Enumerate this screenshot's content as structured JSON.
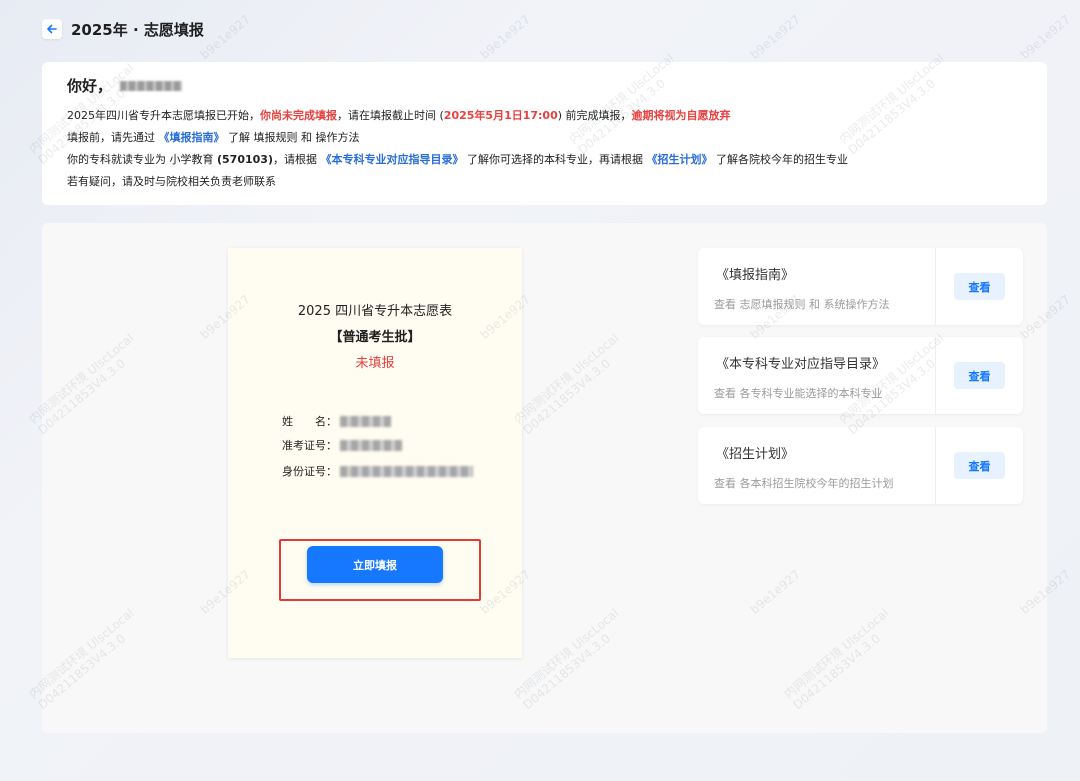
{
  "header": {
    "title": "2025年 · 志愿填报",
    "back_icon": "arrow-left-icon"
  },
  "notice": {
    "greeting": "你好，",
    "line1": {
      "p1": "2025年四川省专升本志愿填报已开始，",
      "warn": "你尚未完成填报",
      "p2": "，请在填报截止时间 (",
      "deadline": "2025年5月1日17:00",
      "p3": ") 前完成填报，",
      "penalty": "逾期将视为自愿放弃"
    },
    "line2": {
      "p1": "填报前，请先通过 ",
      "link": "《填报指南》",
      "p2": " 了解 填报规则 和 操作方法"
    },
    "line3": {
      "p1": "你的专科就读专业为 小学教育 ",
      "major_code": "(570103)",
      "p2": "，请根据 ",
      "link1": "《本专科专业对应指导目录》",
      "p3": " 了解你可选择的本科专业，再请根据 ",
      "link2": "《招生计划》",
      "p4": " 了解各院校今年的招生专业"
    },
    "line4": "若有疑问，请及时与院校相关负责老师联系"
  },
  "form": {
    "title": "2025 四川省专升本志愿表",
    "batch": "【普通考生批】",
    "status": "未填报",
    "name_label": "姓　　名：",
    "exam_no_label": "准考证号：",
    "id_no_label": "身份证号：",
    "submit_label": "立即填报"
  },
  "links": [
    {
      "title": "《填报指南》",
      "desc": "查看 志愿填报规则 和 系统操作方法",
      "button": "查看"
    },
    {
      "title": "《本专科专业对应指导目录》",
      "desc": "查看 各专科专业能选择的本科专业",
      "button": "查看"
    },
    {
      "title": "《招生计划》",
      "desc": "查看 各本科招生院校今年的招生计划",
      "button": "查看"
    }
  ],
  "watermark": {
    "line1": "内网测试环境 UlscLocal",
    "line2": "D04211853V4.3.0",
    "short": "b9e1e927"
  },
  "colors": {
    "primary": "#1677ff",
    "danger": "#e8413f",
    "link": "#2a6ed8",
    "form_bg": "#fffdf1"
  }
}
